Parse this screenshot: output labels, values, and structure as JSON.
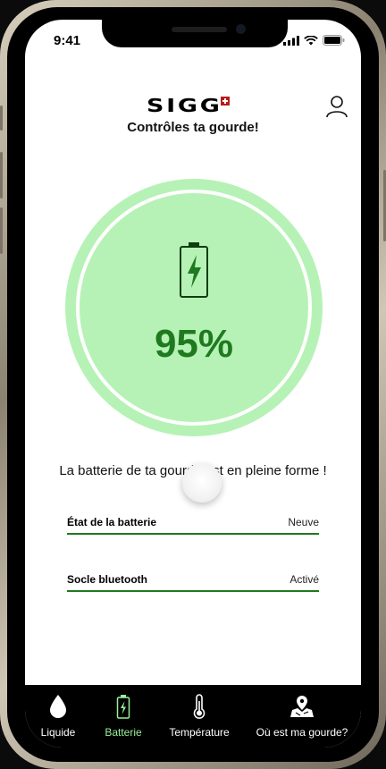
{
  "status_bar": {
    "time": "9:41"
  },
  "header": {
    "logo_text": "SIGG",
    "tagline": "Contrôles ta gourde!"
  },
  "battery": {
    "percent_text": "95%",
    "level": 0.95,
    "message": "La batterie de ta gourde est en pleine forme !",
    "color": "#b6f2b6",
    "accent": "#1f7a1f"
  },
  "details": [
    {
      "label": "État de la batterie",
      "value": "Neuve"
    },
    {
      "label": "Socle bluetooth",
      "value": "Activé"
    }
  ],
  "tabs": [
    {
      "label": "Liquide",
      "icon": "drop-icon",
      "active": false
    },
    {
      "label": "Batterie",
      "icon": "battery-icon",
      "active": true
    },
    {
      "label": "Température",
      "icon": "thermometer-icon",
      "active": false
    },
    {
      "label": "Où est ma gourde?",
      "icon": "map-pin-icon",
      "active": false
    }
  ]
}
